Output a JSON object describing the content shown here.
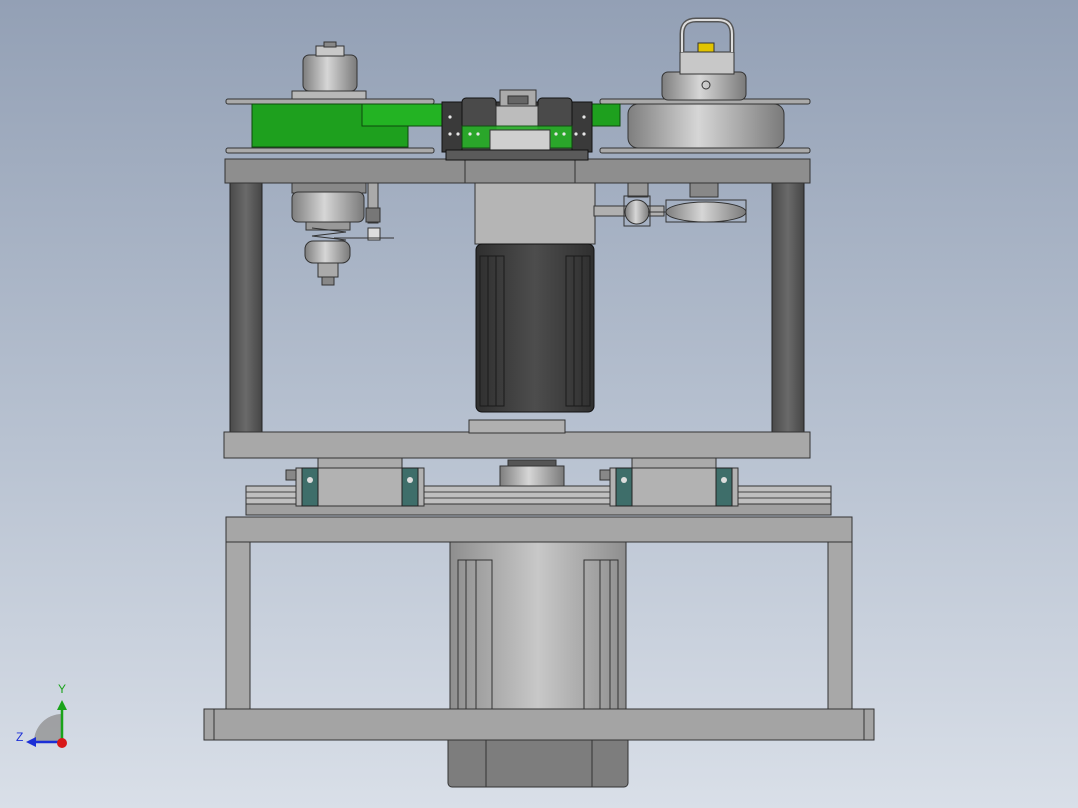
{
  "triad": {
    "y_label": "Y",
    "z_label": "Z",
    "y_color": "#1aa31a",
    "z_color": "#1c2fd6",
    "x_color": "#d81818"
  },
  "colors": {
    "belt": "#1ea01e",
    "steel": "#9a9a9a",
    "steel_light": "#bdbdbd",
    "dark_post": "#5c5c5c",
    "motor_dark": "#3c3c3c",
    "rail_block": "#3e6e6a"
  }
}
